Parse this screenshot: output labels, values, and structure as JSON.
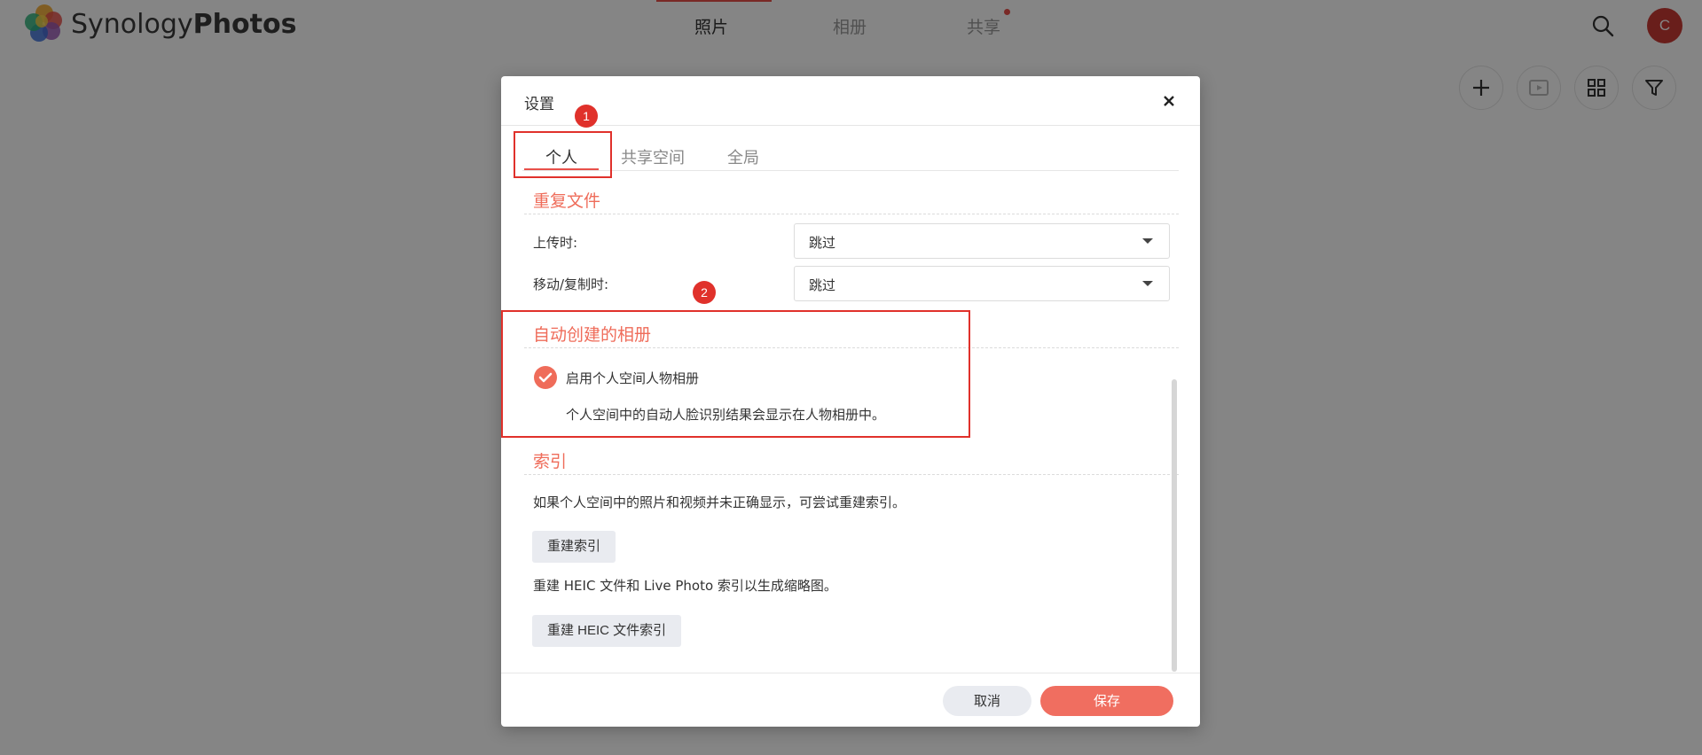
{
  "app": {
    "brand_light": "Synology",
    "brand_bold": "Photos",
    "nav": [
      {
        "label": "照片",
        "active": true
      },
      {
        "label": "相册",
        "active": false
      },
      {
        "label": "共享",
        "active": false
      }
    ],
    "avatar_initial": "C"
  },
  "icons": {
    "search": "search-icon",
    "add": "plus-icon",
    "slideshow": "slideshow-icon",
    "grid": "grid-icon",
    "filter": "filter-icon",
    "close": "close-icon",
    "check": "check-icon"
  },
  "dialog": {
    "title": "设置",
    "tabs": [
      {
        "label": "个人",
        "active": true
      },
      {
        "label": "共享空间",
        "active": false
      },
      {
        "label": "全局",
        "active": false
      }
    ],
    "duplicate": {
      "title": "重复文件",
      "upload_label": "上传时:",
      "upload_value": "跳过",
      "move_label": "移动/复制时:",
      "move_value": "跳过"
    },
    "auto_album": {
      "title": "自动创建的相册",
      "checkbox_label": "启用个人空间人物相册",
      "checked": true,
      "description": "个人空间中的自动人脸识别结果会显示在人物相册中。"
    },
    "index": {
      "title": "索引",
      "description": "如果个人空间中的照片和视频并未正确显示，可尝试重建索引。",
      "rebuild_button": "重建索引",
      "heic_description": "重建 HEIC 文件和 Live Photo 索引以生成缩略图。",
      "heic_button": "重建 HEIC 文件索引"
    },
    "cancel": "取消",
    "save": "保存"
  },
  "annotations": [
    "1",
    "2"
  ],
  "colors": {
    "accent": "#ef6c5a",
    "annotation": "#e0312b",
    "avatar": "#c93a35"
  }
}
